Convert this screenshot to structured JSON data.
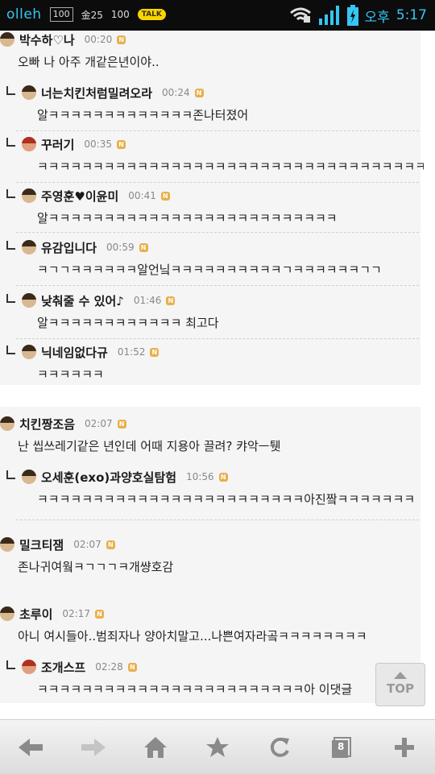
{
  "status_bar": {
    "carrier": "olleh",
    "badge1": "100",
    "small_text": "金25",
    "badge2": "100",
    "kakao_label": "TALK",
    "ampm": "오후",
    "time": "5:17"
  },
  "comments_block1": [
    {
      "nick": "박수하♡나",
      "time": "00:20",
      "text": "오빠 나 아주 개같은년이야..",
      "reply": false,
      "avatar": "dark"
    },
    {
      "nick": "너는치킨처럼밀려오라",
      "time": "00:24",
      "text": "알ㅋㅋㅋㅋㅋㅋㅋㅋㅋㅋㅋㅋㅋ존나터졌어",
      "reply": true,
      "avatar": "dark"
    },
    {
      "nick": "꾸러기",
      "time": "00:35",
      "text": "ㅋㅋㅋㅋㅋㅋㅋㅋㅋㅋㅋㅋㅋㅋㅋㅋㅋㅋㅋㅋㅋㅋㅋㅋㅋㅋㅋㅋㅋㅋㅋㅋㅋㅋㅋ",
      "reply": true,
      "avatar": "red"
    },
    {
      "nick": "주영훈♥이윤미",
      "time": "00:41",
      "text": "알ㅋㅋㅋㅋㅋㅋㅋㅋㅋㅋㅋㅋㅋㅋㅋㅋㅋㅋㅋㅋㅋㅋㅋㅋㅋㅋ",
      "reply": true,
      "avatar": "dark"
    },
    {
      "nick": "유감입니다",
      "time": "00:59",
      "text": "ㅋㄱㄱㅋㅋㅋㅋㅋㅋ알언닠ㅋㅋㅋㅋㅋㅋㅋㅋㅋㅋㄱㅋㅋㅋㅋㅋㅋㄱㄱ",
      "reply": true,
      "avatar": "dark"
    },
    {
      "nick": "낮춰줄 수 있어♪",
      "time": "01:46",
      "text": "알ㅋㅋㅋㅋㅋㅋㅋㅋㅋㅋㅋㅋ 최고다",
      "reply": true,
      "avatar": "dark"
    },
    {
      "nick": "닉네임없다규",
      "time": "01:52",
      "text": "ㅋㅋㅋㅋㅋㅋ",
      "reply": true,
      "avatar": "dark"
    }
  ],
  "comments_block2": [
    {
      "nick": "치킨짱조음",
      "time": "02:07",
      "text": "난 씹쓰레기같은 년인데 어때 지용아 끌려? 캬악ㅡ퉷",
      "reply": false,
      "avatar": "dark"
    },
    {
      "nick": "오세훈(exo)과양호실탐험",
      "time": "10:56",
      "text": "ㅋㅋㅋㅋㅋㅋㅋㅋㅋㅋㅋㅋㅋㅋㅋㅋㅋㅋㅋㅋㅋㅋㅋㅋ아진짴ㅋㅋㅋㅋㅋㅋㅋ",
      "reply": true,
      "avatar": "dark"
    },
    {
      "nick": "밀크티잼",
      "time": "02:07",
      "text": "존나귀여웤ㅋㄱㄱㄱㅋ개썅호감",
      "reply": false,
      "avatar": "dark"
    },
    {
      "nick": "초루이",
      "time": "02:17",
      "text": "아니 여시들아..범죄자나 양아치말고...나쁜여자라곸ㅋㅋㅋㅋㅋㅋㅋㅋ",
      "reply": false,
      "avatar": "dark"
    },
    {
      "nick": "조개스프",
      "time": "02:28",
      "text": "ㅋㅋㅋㅋㅋㅋㅋㅋㅋㅋㅋㅋㅋㅋㅋㅋㅋㅋㅋㅋㅋㅋㅋㅋ아 이댓글",
      "reply": true,
      "avatar": "red"
    }
  ],
  "top_button": {
    "label": "TOP"
  },
  "toolbar": {
    "tab_count": "8"
  }
}
